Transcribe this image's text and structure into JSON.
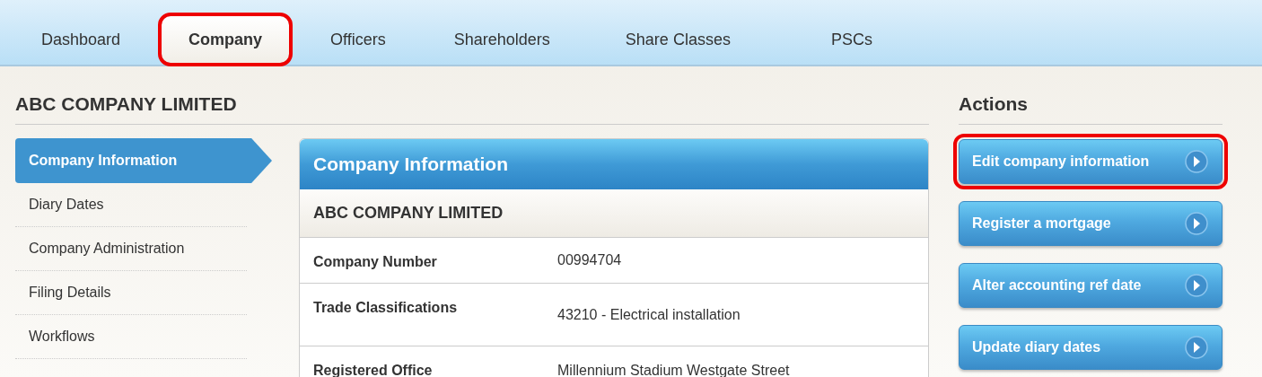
{
  "tabs": [
    {
      "label": "Dashboard",
      "selected": false,
      "highlighted": false
    },
    {
      "label": "Company",
      "selected": true,
      "highlighted": true
    },
    {
      "label": "Officers",
      "selected": false,
      "highlighted": false
    },
    {
      "label": "Shareholders",
      "selected": false,
      "highlighted": false
    },
    {
      "label": "Share Classes",
      "selected": false,
      "highlighted": false
    },
    {
      "label": "PSCs",
      "selected": false,
      "highlighted": false
    }
  ],
  "company_title": "ABC COMPANY LIMITED",
  "sidebar": {
    "items": [
      {
        "label": "Company Information",
        "selected": true
      },
      {
        "label": "Diary Dates",
        "selected": false
      },
      {
        "label": "Company Administration",
        "selected": false
      },
      {
        "label": "Filing Details",
        "selected": false
      },
      {
        "label": "Workflows",
        "selected": false
      }
    ]
  },
  "panel": {
    "title": "Company Information",
    "subtitle": "ABC COMPANY LIMITED",
    "rows": [
      {
        "label": "Company Number",
        "value": "00994704"
      },
      {
        "label": "Trade Classifications",
        "value": "43210 - Electrical installation"
      },
      {
        "label": "Registered Office",
        "value": "Millennium Stadium Westgate Street"
      }
    ]
  },
  "actions": {
    "title": "Actions",
    "buttons": [
      {
        "label": "Edit company information",
        "highlighted": true
      },
      {
        "label": "Register a mortgage",
        "highlighted": false
      },
      {
        "label": "Alter accounting ref date",
        "highlighted": false
      },
      {
        "label": "Update diary dates",
        "highlighted": false
      }
    ]
  }
}
